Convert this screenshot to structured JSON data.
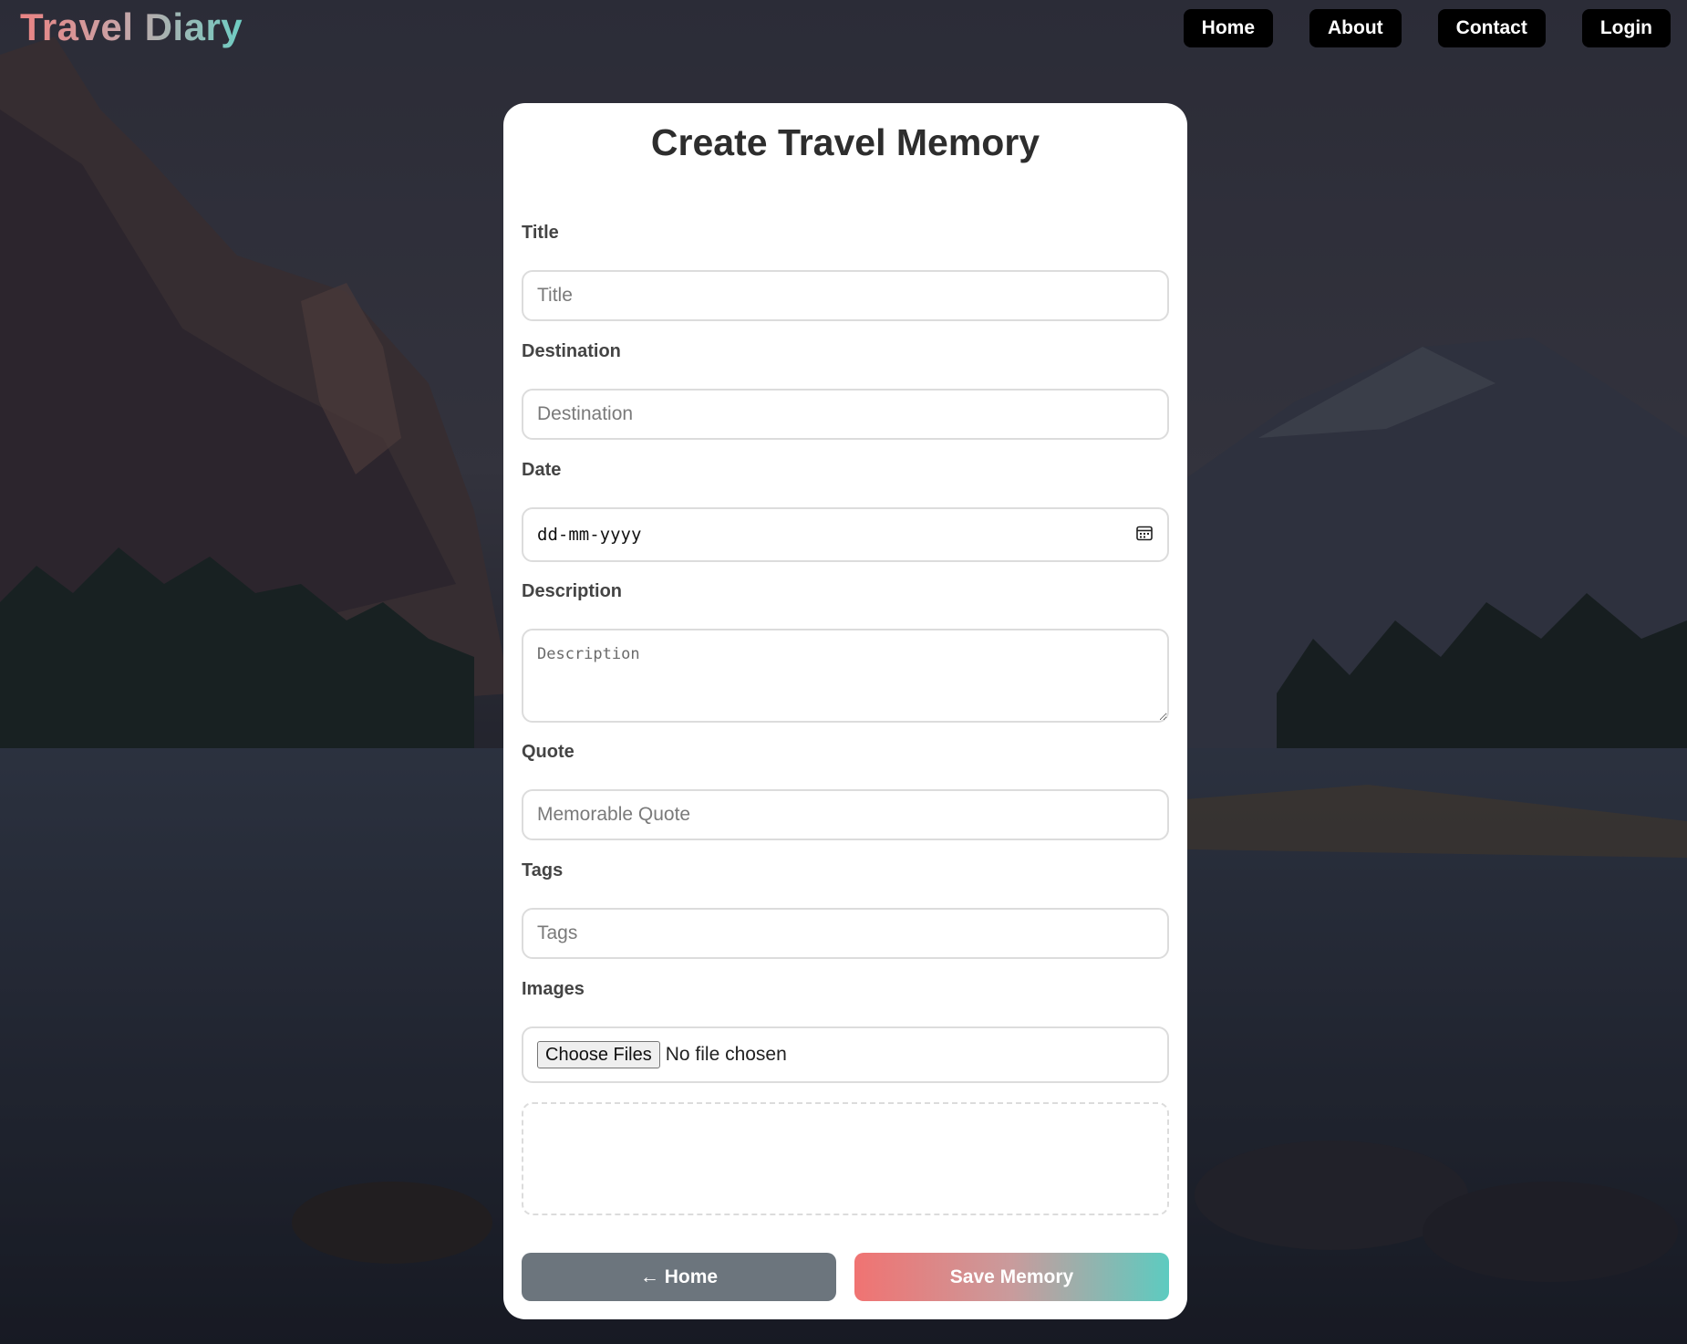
{
  "brand": "Travel Diary",
  "nav": [
    "Home",
    "About",
    "Contact",
    "Login"
  ],
  "form": {
    "heading": "Create Travel Memory",
    "title_label": "Title",
    "title_placeholder": "Title",
    "destination_label": "Destination",
    "destination_placeholder": "Destination",
    "date_label": "Date",
    "date_value": "dd-mm-yyyy",
    "description_label": "Description",
    "description_placeholder": "Description",
    "quote_label": "Quote",
    "quote_placeholder": "Memorable Quote",
    "tags_label": "Tags",
    "tags_placeholder": "Tags",
    "images_label": "Images",
    "file_button": "Choose Files",
    "file_status": "No file chosen"
  },
  "actions": {
    "home_label": "← Home",
    "save_label": "Save Memory"
  },
  "colors": {
    "brand_gradient": [
      "#e98383",
      "#6ecdc3"
    ],
    "home_button": "#6c757d",
    "save_gradient": [
      "#f07372",
      "#5dcbc0"
    ]
  }
}
